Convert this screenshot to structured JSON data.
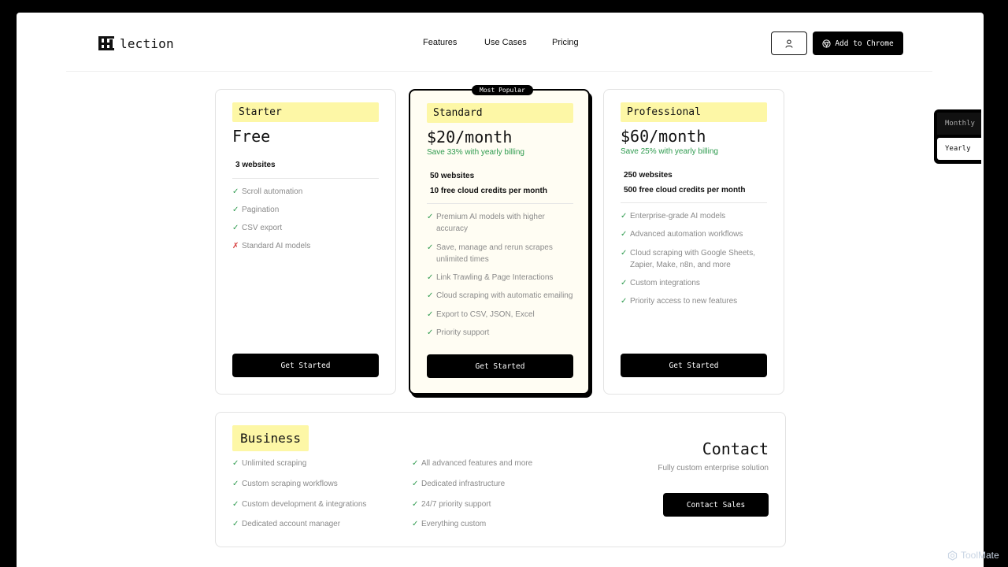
{
  "brand": {
    "name": "lection"
  },
  "nav": {
    "items": [
      "Features",
      "Use Cases",
      "Pricing"
    ]
  },
  "header": {
    "add_to_chrome": "Add to Chrome"
  },
  "billing_toggle": {
    "monthly": "Monthly",
    "yearly": "Yearly",
    "selected": "Yearly"
  },
  "plans": [
    {
      "name": "Starter",
      "price": "Free",
      "save": "",
      "quota": [
        "3 websites"
      ],
      "features": [
        {
          "text": "Scroll automation",
          "included": true
        },
        {
          "text": "Pagination",
          "included": true
        },
        {
          "text": "CSV export",
          "included": true
        },
        {
          "text": "Standard AI models",
          "included": false
        }
      ],
      "cta": "Get Started"
    },
    {
      "name": "Standard",
      "badge": "Most Popular",
      "price": "$20/month",
      "save": "Save 33% with yearly billing",
      "quota": [
        "50 websites",
        "10 free cloud credits per month"
      ],
      "features": [
        {
          "text": "Premium AI models with higher accuracy",
          "included": true
        },
        {
          "text": "Save, manage and rerun scrapes unlimited times",
          "included": true
        },
        {
          "text": "Link Trawling & Page Interactions",
          "included": true
        },
        {
          "text": "Cloud scraping with automatic emailing",
          "included": true
        },
        {
          "text": "Export to CSV, JSON, Excel",
          "included": true
        },
        {
          "text": "Priority support",
          "included": true
        }
      ],
      "cta": "Get Started"
    },
    {
      "name": "Professional",
      "price": "$60/month",
      "save": "Save 25% with yearly billing",
      "quota": [
        "250 websites",
        "500 free cloud credits per month"
      ],
      "features": [
        {
          "text": "Enterprise-grade AI models",
          "included": true
        },
        {
          "text": "Advanced automation workflows",
          "included": true
        },
        {
          "text": "Cloud scraping with Google Sheets, Zapier, Make, n8n, and more",
          "included": true
        },
        {
          "text": "Custom integrations",
          "included": true
        },
        {
          "text": "Priority access to new features",
          "included": true
        }
      ],
      "cta": "Get Started"
    }
  ],
  "business": {
    "name": "Business",
    "features_left": [
      "Unlimited scraping",
      "Custom scraping workflows",
      "Custom development & integrations",
      "Dedicated account manager"
    ],
    "features_right": [
      "All advanced features and more",
      "Dedicated infrastructure",
      "24/7 priority support",
      "Everything custom"
    ],
    "contact_title": "Contact",
    "contact_subtitle": "Fully custom enterprise solution",
    "contact_button": "Contact Sales"
  },
  "marks": {
    "yes": "✓",
    "no": "✗"
  },
  "watermark": "ToolMate",
  "colors": {
    "accent_highlight": "#fdf7a6",
    "save_green": "#2f9b4f",
    "check_green": "#2f9b4f",
    "cross_red": "#d63c3c"
  },
  "icons": [
    "user-icon",
    "chrome-icon",
    "check-icon",
    "cross-icon"
  ]
}
